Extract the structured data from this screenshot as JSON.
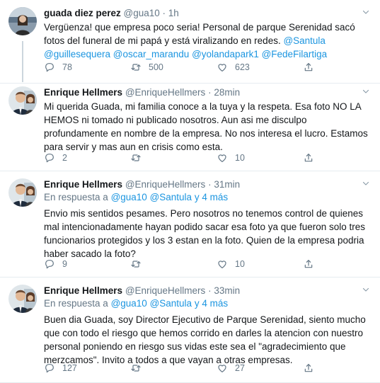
{
  "tweets": [
    {
      "name": "guada diez perez",
      "handle": "@gua10",
      "time": "1h",
      "text_parts": [
        "Vergüenza! que empresa poco seria! Personal de parque Serenidad sacó fotos del funeral de mi papá y está viralizando en redes. ",
        "@Santula",
        " ",
        "@guillesequera",
        " ",
        "@oscar_marandu",
        "  ",
        "@yolandapark1",
        " ",
        "@FedeFilartiga"
      ],
      "replies": "78",
      "retweets": "500",
      "likes": "623"
    },
    {
      "name": "Enrique Hellmers",
      "handle": "@EnriqueHellmers",
      "time": "28min",
      "text": "Mi querida Guada, mi familia conoce a la tuya y la respeta. Esa foto NO LA HEMOS ni tomado ni publicado nosotros. Aun asi me disculpo profundamente en nombre de la empresa. No nos interesa el lucro. Estamos para servir y mas aun en crisis como esta.",
      "replies": "2",
      "retweets": "",
      "likes": "10"
    },
    {
      "name": "Enrique Hellmers",
      "handle": "@EnriqueHellmers",
      "time": "31min",
      "reply_prefix": "En respuesta a ",
      "reply_to_1": "@gua10",
      "reply_to_2": "@Santula",
      "reply_more": "y 4 más",
      "text": "Envio mis sentidos pesames. Pero nosotros no tenemos control de quienes mal intencionadamente hayan podido sacar esa foto ya que fueron solo tres funcionarios protegidos y los 3 estan en la foto. Quien de la empresa podria haber sacado la foto?",
      "replies": "9",
      "retweets": "",
      "likes": "10"
    },
    {
      "name": "Enrique Hellmers",
      "handle": "@EnriqueHellmers",
      "time": "33min",
      "reply_prefix": "En respuesta a ",
      "reply_to_1": "@gua10",
      "reply_to_2": "@Santula",
      "reply_more": "y 4 más",
      "text": "Buen dia Guada, soy Director Ejecutivo de Parque Serenidad, siento mucho que con todo el riesgo que hemos corrido en darles la atencion con nuestro personal poniendo en riesgo sus vidas este sea el \"agradecimiento que merzcamos\". Invito a todos a que vayan a otras empresas.",
      "replies": "127",
      "retweets": "",
      "likes": "27"
    }
  ],
  "sep": " · ",
  "colors": {
    "link": "#1b95e0",
    "muted": "#657786",
    "border": "#e6ecf0"
  }
}
